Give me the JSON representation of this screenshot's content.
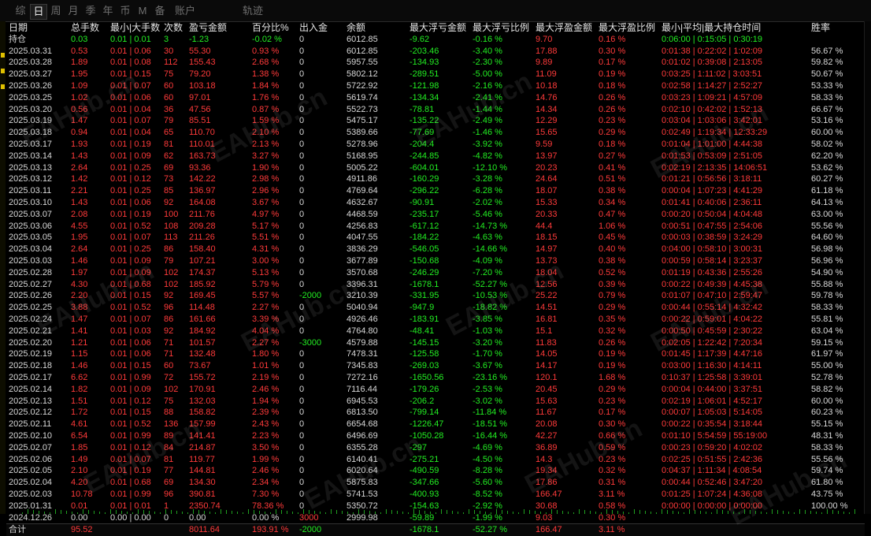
{
  "tabs": [
    "综",
    "日",
    "周",
    "月",
    "季",
    "年",
    "币",
    "M",
    "备",
    "账户",
    "轨迹"
  ],
  "active_tab": 1,
  "headers": [
    "日期",
    "总手数",
    "最小|大手数",
    "次数",
    "盈亏金额",
    "百分比%",
    "出入金",
    "余额",
    "最大浮亏金额",
    "最大浮亏比例",
    "最大浮盈金额",
    "最大浮盈比例",
    "最小|平均|最大持仓时间",
    "胜率"
  ],
  "holding": [
    "持仓",
    "0.03",
    "0.01 | 0.01",
    "3",
    "-1.23",
    "-0.02 %",
    "0",
    "6012.85",
    "-9.62",
    "-0.16 %",
    "9.70",
    "0.16 %",
    "0:06:00 | 0:15:05 | 0:30:19",
    ""
  ],
  "rows": [
    [
      "2025.03.31",
      "0.53",
      "0.01 | 0.06",
      "30",
      "55.30",
      "0.93 %",
      "0",
      "6012.85",
      "-203.46",
      "-3.40 %",
      "17.88",
      "0.30 %",
      "0:01:38 | 0:22:02 | 1:02:09",
      "56.67 %"
    ],
    [
      "2025.03.28",
      "1.89",
      "0.01 | 0.08",
      "112",
      "155.43",
      "2.68 %",
      "0",
      "5957.55",
      "-134.93",
      "-2.30 %",
      "9.89",
      "0.17 %",
      "0:01:02 | 0:39:08 | 2:13:05",
      "59.82 %"
    ],
    [
      "2025.03.27",
      "1.95",
      "0.01 | 0.15",
      "75",
      "79.20",
      "1.38 %",
      "0",
      "5802.12",
      "-289.51",
      "-5.00 %",
      "11.09",
      "0.19 %",
      "0:03:25 | 1:11:02 | 3:03:51",
      "50.67 %"
    ],
    [
      "2025.03.26",
      "1.09",
      "0.01 | 0.07",
      "60",
      "103.18",
      "1.84 %",
      "0",
      "5722.92",
      "-121.98",
      "-2.16 %",
      "10.18",
      "0.18 %",
      "0:02:58 | 1:14:27 | 2:52:27",
      "53.33 %"
    ],
    [
      "2025.03.25",
      "1.02",
      "0.01 | 0.06",
      "60",
      "97.01",
      "1.76 %",
      "0",
      "5619.74",
      "-134.34",
      "-2.41 %",
      "14.76",
      "0.26 %",
      "0:03:23 | 1:09:21 | 4:57:09",
      "58.33 %"
    ],
    [
      "2025.03.20",
      "0.56",
      "0.01 | 0.04",
      "36",
      "47.56",
      "0.87 %",
      "0",
      "5522.73",
      "-78.81",
      "-1.44 %",
      "14.34",
      "0.26 %",
      "0:02:10 | 0:42:02 | 1:52:13",
      "66.67 %"
    ],
    [
      "2025.03.19",
      "1.47",
      "0.01 | 0.07",
      "79",
      "85.51",
      "1.59 %",
      "0",
      "5475.17",
      "-135.22",
      "-2.49 %",
      "12.29",
      "0.23 %",
      "0:03:04 | 1:03:06 | 3:42:01",
      "53.16 %"
    ],
    [
      "2025.03.18",
      "0.94",
      "0.01 | 0.04",
      "65",
      "110.70",
      "2.10 %",
      "0",
      "5389.66",
      "-77.69",
      "-1.46 %",
      "15.65",
      "0.29 %",
      "0:02:49 | 1:19:34 | 12:33:29",
      "60.00 %"
    ],
    [
      "2025.03.17",
      "1.93",
      "0.01 | 0.19",
      "81",
      "110.01",
      "2.13 %",
      "0",
      "5278.96",
      "-204.4",
      "-3.92 %",
      "9.59",
      "0.18 %",
      "0:01:04 | 1:01:00 | 4:44:38",
      "58.02 %"
    ],
    [
      "2025.03.14",
      "1.43",
      "0.01 | 0.09",
      "62",
      "163.73",
      "3.27 %",
      "0",
      "5168.95",
      "-244.85",
      "-4.82 %",
      "13.97",
      "0.27 %",
      "0:01:53 | 0:53:09 | 2:51:05",
      "62.20 %"
    ],
    [
      "2025.03.13",
      "2.64",
      "0.01 | 0.25",
      "69",
      "93.36",
      "1.90 %",
      "0",
      "5005.22",
      "-604.01",
      "-12.10 %",
      "20.23",
      "0.41 %",
      "0:02:19 | 2:13:35 | 14:06:51",
      "53.62 %"
    ],
    [
      "2025.03.12",
      "1.42",
      "0.01 | 0.12",
      "73",
      "142.22",
      "2.98 %",
      "0",
      "4911.86",
      "-160.29",
      "-3.28 %",
      "24.64",
      "0.51 %",
      "0:01:21 | 0:56:56 | 3:18:11",
      "60.27 %"
    ],
    [
      "2025.03.11",
      "2.21",
      "0.01 | 0.25",
      "85",
      "136.97",
      "2.96 %",
      "0",
      "4769.64",
      "-296.22",
      "-6.28 %",
      "18.07",
      "0.38 %",
      "0:00:04 | 1:07:23 | 4:41:29",
      "61.18 %"
    ],
    [
      "2025.03.10",
      "1.43",
      "0.01 | 0.06",
      "92",
      "164.08",
      "3.67 %",
      "0",
      "4632.67",
      "-90.91",
      "-2.02 %",
      "15.33",
      "0.34 %",
      "0:01:41 | 0:40:06 | 2:36:11",
      "64.13 %"
    ],
    [
      "2025.03.07",
      "2.08",
      "0.01 | 0.19",
      "100",
      "211.76",
      "4.97 %",
      "0",
      "4468.59",
      "-235.17",
      "-5.46 %",
      "20.33",
      "0.47 %",
      "0:00:20 | 0:50:04 | 4:04:48",
      "63.00 %"
    ],
    [
      "2025.03.06",
      "4.55",
      "0.01 | 0.52",
      "108",
      "209.28",
      "5.17 %",
      "0",
      "4256.83",
      "-617.12",
      "-14.73 %",
      "44.4",
      "1.06 %",
      "0:00:51 | 0:47:55 | 2:54:06",
      "55.56 %"
    ],
    [
      "2025.03.05",
      "1.95",
      "0.01 | 0.07",
      "113",
      "211.26",
      "5.51 %",
      "0",
      "4047.55",
      "-184.22",
      "-4.63 %",
      "18.15",
      "0.45 %",
      "0:00:03 | 0:38:59 | 3:24:29",
      "64.60 %"
    ],
    [
      "2025.03.04",
      "2.64",
      "0.01 | 0.25",
      "86",
      "158.40",
      "4.31 %",
      "0",
      "3836.29",
      "-546.05",
      "-14.66 %",
      "14.97",
      "0.40 %",
      "0:04:00 | 0:58:10 | 3:00:31",
      "56.98 %"
    ],
    [
      "2025.03.03",
      "1.46",
      "0.01 | 0.09",
      "79",
      "107.21",
      "3.00 %",
      "0",
      "3677.89",
      "-150.68",
      "-4.09 %",
      "13.73",
      "0.38 %",
      "0:00:59 | 0:58:14 | 3:23:37",
      "56.96 %"
    ],
    [
      "2025.02.28",
      "1.97",
      "0.01 | 0.09",
      "102",
      "174.37",
      "5.13 %",
      "0",
      "3570.68",
      "-246.29",
      "-7.20 %",
      "18.04",
      "0.52 %",
      "0:01:19 | 0:43:36 | 2:55:26",
      "54.90 %"
    ],
    [
      "2025.02.27",
      "4.30",
      "0.01 | 0.68",
      "102",
      "185.92",
      "5.79 %",
      "0",
      "3396.31",
      "-1678.1",
      "-52.27 %",
      "12.56",
      "0.39 %",
      "0:00:22 | 0:49:39 | 4:45:38",
      "55.88 %"
    ],
    [
      "2025.02.26",
      "2.20",
      "0.01 | 0.15",
      "92",
      "169.45",
      "5.57 %",
      "-2000",
      "3210.39",
      "-331.95",
      "-10.53 %",
      "25.22",
      "0.79 %",
      "0:01:07 | 0:47:10 | 2:59:47",
      "59.78 %"
    ],
    [
      "2025.02.25",
      "3.88",
      "0.01 | 0.52",
      "96",
      "114.48",
      "2.27 %",
      "0",
      "5040.94",
      "-947.9",
      "-18.82 %",
      "14.51",
      "0.29 %",
      "0:00:44 | 0:55:14 | 4:32:42",
      "58.33 %"
    ],
    [
      "2025.02.24",
      "1.47",
      "0.01 | 0.07",
      "86",
      "161.66",
      "3.39 %",
      "0",
      "4926.46",
      "-183.91",
      "-3.85 %",
      "16.81",
      "0.35 %",
      "0:00:22 | 0:59:01 | 4:04:22",
      "55.81 %"
    ],
    [
      "2025.02.21",
      "1.41",
      "0.01 | 0.03",
      "92",
      "184.92",
      "4.04 %",
      "0",
      "4764.80",
      "-48.41",
      "-1.03 %",
      "15.1",
      "0.32 %",
      "0:00:50 | 0:45:59 | 2:30:22",
      "63.04 %"
    ],
    [
      "2025.02.20",
      "1.21",
      "0.01 | 0.06",
      "71",
      "101.57",
      "2.27 %",
      "-3000",
      "4579.88",
      "-145.15",
      "-3.20 %",
      "11.83",
      "0.26 %",
      "0:02:05 | 1:22:42 | 7:20:34",
      "59.15 %"
    ],
    [
      "2025.02.19",
      "1.15",
      "0.01 | 0.06",
      "71",
      "132.48",
      "1.80 %",
      "0",
      "7478.31",
      "-125.58",
      "-1.70 %",
      "14.05",
      "0.19 %",
      "0:01:45 | 1:17:39 | 4:47:16",
      "61.97 %"
    ],
    [
      "2025.02.18",
      "1.46",
      "0.01 | 0.15",
      "60",
      "73.67",
      "1.01 %",
      "0",
      "7345.83",
      "-269.03",
      "-3.67 %",
      "14.17",
      "0.19 %",
      "0:03:00 | 1:16:30 | 4:14:11",
      "55.00 %"
    ],
    [
      "2025.02.17",
      "6.62",
      "0.01 | 0.99",
      "72",
      "155.72",
      "2.19 %",
      "0",
      "7272.16",
      "-1650.56",
      "-23.16 %",
      "120.1",
      "1.68 %",
      "0:10:37 | 1:25:58 | 3:39:01",
      "52.78 %"
    ],
    [
      "2025.02.14",
      "1.82",
      "0.01 | 0.09",
      "102",
      "170.91",
      "2.46 %",
      "0",
      "7116.44",
      "-179.26",
      "-2.53 %",
      "20.45",
      "0.29 %",
      "0:00:04 | 0:44:00 | 3:37:51",
      "58.82 %"
    ],
    [
      "2025.02.13",
      "1.51",
      "0.01 | 0.12",
      "75",
      "132.03",
      "1.94 %",
      "0",
      "6945.53",
      "-206.2",
      "-3.02 %",
      "15.63",
      "0.23 %",
      "0:02:19 | 1:06:01 | 4:52:17",
      "60.00 %"
    ],
    [
      "2025.02.12",
      "1.72",
      "0.01 | 0.15",
      "88",
      "158.82",
      "2.39 %",
      "0",
      "6813.50",
      "-799.14",
      "-11.84 %",
      "11.67",
      "0.17 %",
      "0:00:07 | 1:05:03 | 5:14:05",
      "60.23 %"
    ],
    [
      "2025.02.11",
      "4.61",
      "0.01 | 0.52",
      "136",
      "157.99",
      "2.43 %",
      "0",
      "6654.68",
      "-1226.47",
      "-18.51 %",
      "20.08",
      "0.30 %",
      "0:00:22 | 0:35:54 | 3:18:44",
      "55.15 %"
    ],
    [
      "2025.02.10",
      "6.54",
      "0.01 | 0.99",
      "89",
      "141.41",
      "2.23 %",
      "0",
      "6496.69",
      "-1050.28",
      "-16.44 %",
      "42.27",
      "0.66 %",
      "0:01:10 | 5:54:59 | 55:19:00",
      "48.31 %"
    ],
    [
      "2025.02.07",
      "1.85",
      "0.01 | 0.12",
      "84",
      "214.87",
      "3.50 %",
      "0",
      "6355.28",
      "-297",
      "-4.69 %",
      "36.89",
      "0.59 %",
      "0:00:23 | 0:59:20 | 4:02:02",
      "58.33 %"
    ],
    [
      "2025.02.06",
      "1.49",
      "0.01 | 0.07",
      "81",
      "119.77",
      "1.99 %",
      "0",
      "6140.41",
      "-275.21",
      "-4.50 %",
      "14.3",
      "0.23 %",
      "0:02:25 | 0:51:55 | 2:42:36",
      "55.56 %"
    ],
    [
      "2025.02.05",
      "2.10",
      "0.01 | 0.19",
      "77",
      "144.81",
      "2.46 %",
      "0",
      "6020.64",
      "-490.59",
      "-8.28 %",
      "19.34",
      "0.32 %",
      "0:04:37 | 1:11:34 | 4:08:54",
      "59.74 %"
    ],
    [
      "2025.02.04",
      "4.20",
      "0.01 | 0.68",
      "69",
      "134.30",
      "2.34 %",
      "0",
      "5875.83",
      "-347.66",
      "-5.60 %",
      "17.86",
      "0.31 %",
      "0:00:44 | 0:52:46 | 3:47:20",
      "61.80 %"
    ],
    [
      "2025.02.03",
      "10.78",
      "0.01 | 0.99",
      "96",
      "390.81",
      "7.30 %",
      "0",
      "5741.53",
      "-400.93",
      "-8.52 %",
      "166.47",
      "3.11 %",
      "0:01:25 | 1:07:24 | 4:36:08",
      "43.75 %"
    ],
    [
      "2025.01.31",
      "0.01",
      "0.01 | 0.01",
      "1",
      "2350.74",
      "78.36 %",
      "0",
      "5350.72",
      "-154.63",
      "-2.92 %",
      "30.68",
      "0.58 %",
      "0:00:00 | 0:00:00 | 0:00:00",
      "100.00 %"
    ],
    [
      "2024.12.26",
      "0.00",
      "0.00 | 0.00",
      "0",
      "0.00",
      "0.00 %",
      "3000",
      "2999.98",
      "-59.89",
      "-1.99 %",
      "9.03",
      "0.30 %",
      "",
      "",
      ""
    ]
  ],
  "total": [
    "合计",
    "95.52",
    "",
    "",
    "8011.64",
    "193.91 %",
    "-2000",
    "",
    "-1678.1",
    "-52.27 %",
    "166.47",
    "3.11 %",
    "",
    ""
  ],
  "watermark": "EAHub.cn",
  "colors": {
    "profit": "#ff3a3a",
    "loss": "#22ee22",
    "text": "#d8d8d8",
    "background": "#000000"
  }
}
